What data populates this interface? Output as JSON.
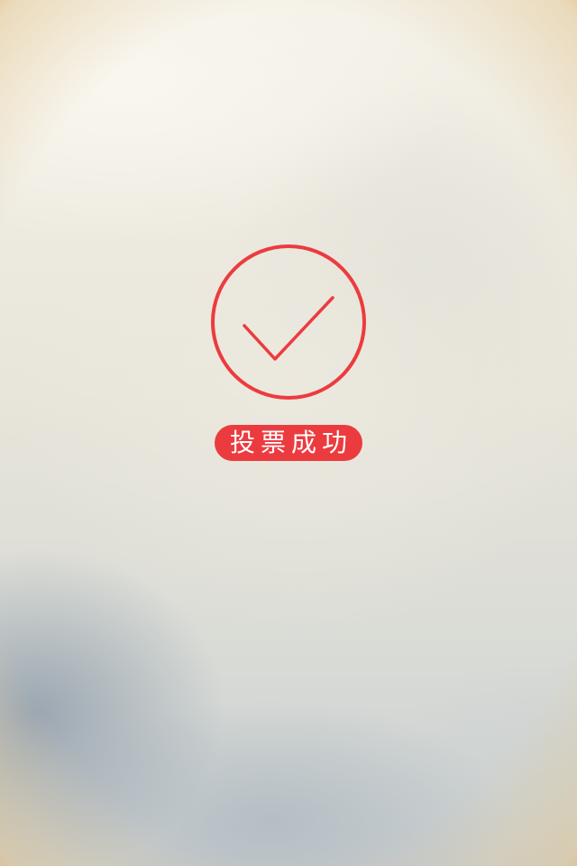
{
  "result": {
    "status_icon": "check-circle-icon",
    "message": "投票成功",
    "accent_color": "#ec3b3f"
  }
}
